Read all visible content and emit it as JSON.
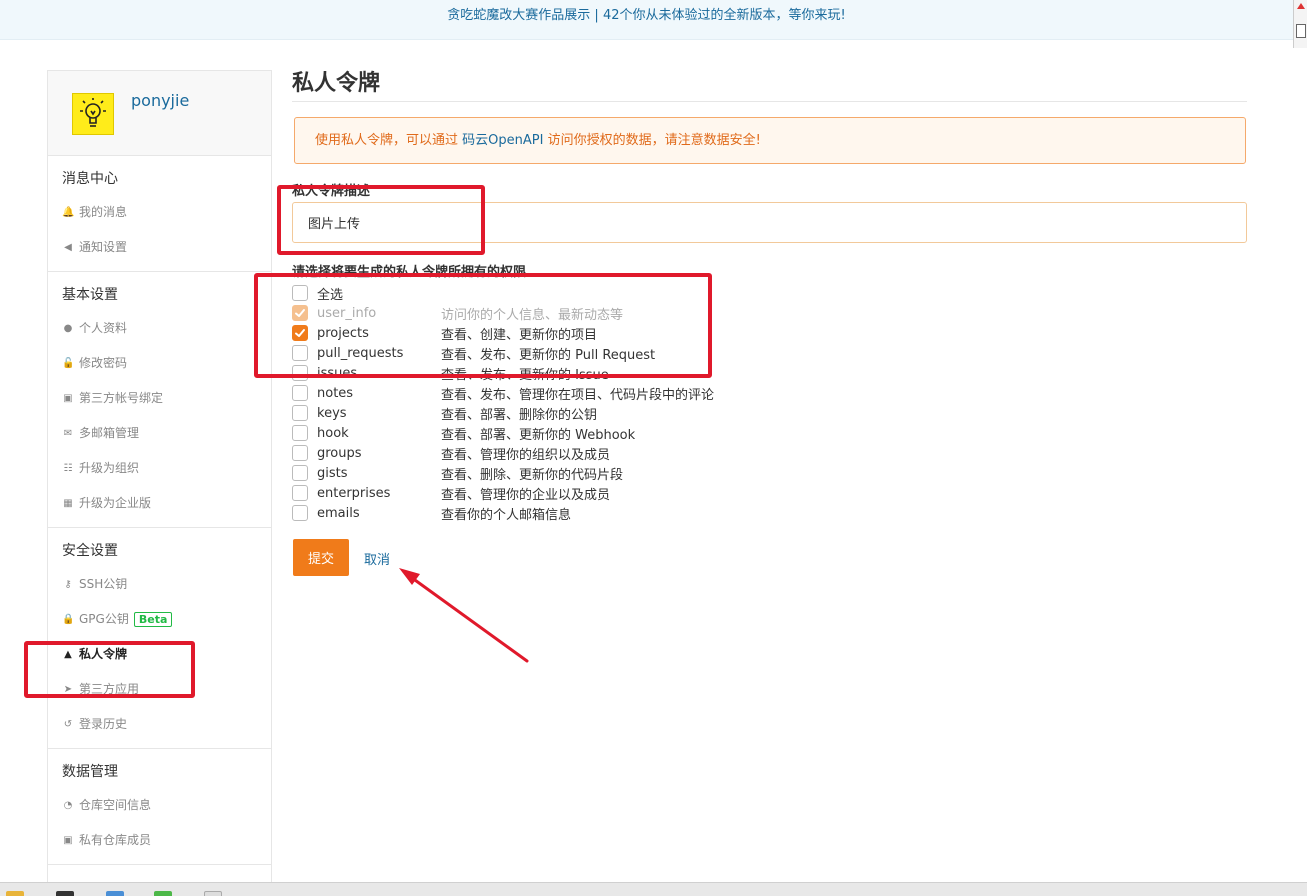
{
  "banner": {
    "text": "贪吃蛇魔改大赛作品展示 | 42个你从未体验过的全新版本，等你来玩!"
  },
  "user": {
    "name": "ponyjie"
  },
  "sidebar": {
    "sections": [
      {
        "title": "消息中心",
        "items": [
          {
            "label": "我的消息",
            "icon": "bell-icon",
            "glyph": "🔔"
          },
          {
            "label": "通知设置",
            "icon": "speaker-icon",
            "glyph": "◀"
          }
        ]
      },
      {
        "title": "基本设置",
        "items": [
          {
            "label": "个人资料",
            "icon": "user-icon",
            "glyph": "●"
          },
          {
            "label": "修改密码",
            "icon": "unlock-icon",
            "glyph": "🔓"
          },
          {
            "label": "第三方帐号绑定",
            "icon": "id-badge-icon",
            "glyph": "▣"
          },
          {
            "label": "多邮箱管理",
            "icon": "envelope-icon",
            "glyph": "✉"
          },
          {
            "label": "升级为组织",
            "icon": "users-icon",
            "glyph": "☷"
          },
          {
            "label": "升级为企业版",
            "icon": "building-icon",
            "glyph": "▦"
          }
        ]
      },
      {
        "title": "安全设置",
        "items": [
          {
            "label": "SSH公钥",
            "icon": "key-icon",
            "glyph": "⚷"
          },
          {
            "label": "GPG公钥",
            "icon": "lock-icon",
            "glyph": "🔒",
            "badge": "Beta"
          },
          {
            "label": "私人令牌",
            "icon": "user-secret-icon",
            "glyph": "▲",
            "active": true
          },
          {
            "label": "第三方应用",
            "icon": "rocket-icon",
            "glyph": "➤"
          },
          {
            "label": "登录历史",
            "icon": "history-icon",
            "glyph": "↺"
          }
        ]
      },
      {
        "title": "数据管理",
        "items": [
          {
            "label": "仓库空间信息",
            "icon": "pie-chart-icon",
            "glyph": "◔"
          },
          {
            "label": "私有仓库成员",
            "icon": "contact-card-icon",
            "glyph": "▣"
          }
        ]
      }
    ]
  },
  "main": {
    "title": "私人令牌",
    "notice": {
      "before": "使用私人令牌，可以通过 ",
      "link": "码云OpenAPI",
      "after": " 访问你授权的数据，请注意数据安全!"
    },
    "desc_label": "私人令牌描述",
    "desc_value": "图片上传",
    "perm_label": "请选择将要生成的私人令牌所拥有的权限",
    "permissions": [
      {
        "name": "全选",
        "desc": "",
        "checked": false,
        "disabled": false
      },
      {
        "name": "user_info",
        "desc": "访问你的个人信息、最新动态等",
        "checked": true,
        "disabled": true
      },
      {
        "name": "projects",
        "desc": "查看、创建、更新你的项目",
        "checked": true,
        "disabled": false
      },
      {
        "name": "pull_requests",
        "desc": "查看、发布、更新你的 Pull Request",
        "checked": false,
        "disabled": false
      },
      {
        "name": "issues",
        "desc": "查看、发布、更新你的 Issue",
        "checked": false,
        "disabled": false
      },
      {
        "name": "notes",
        "desc": "查看、发布、管理你在项目、代码片段中的评论",
        "checked": false,
        "disabled": false
      },
      {
        "name": "keys",
        "desc": "查看、部署、删除你的公钥",
        "checked": false,
        "disabled": false
      },
      {
        "name": "hook",
        "desc": "查看、部署、更新你的 Webhook",
        "checked": false,
        "disabled": false
      },
      {
        "name": "groups",
        "desc": "查看、管理你的组织以及成员",
        "checked": false,
        "disabled": false
      },
      {
        "name": "gists",
        "desc": "查看、删除、更新你的代码片段",
        "checked": false,
        "disabled": false
      },
      {
        "name": "enterprises",
        "desc": "查看、管理你的企业以及成员",
        "checked": false,
        "disabled": false
      },
      {
        "name": "emails",
        "desc": "查看你的个人邮箱信息",
        "checked": false,
        "disabled": false
      }
    ],
    "submit_label": "提交",
    "cancel_label": "取消"
  },
  "colors": {
    "accent": "#f07b1a",
    "link": "#1a6a9c",
    "annotation": "#e0192b",
    "beta": "#21ba45"
  }
}
